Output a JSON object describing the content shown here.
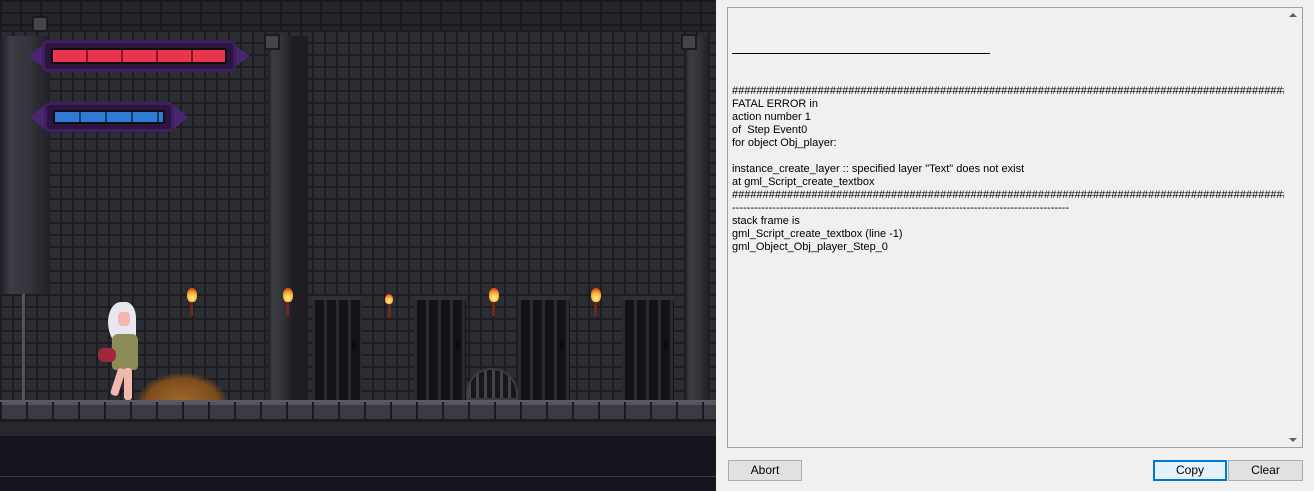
{
  "game": {
    "health": 1.0,
    "mana": 1.0,
    "colors": {
      "health": "#e8364f",
      "mana": "#2f7bd3",
      "frame": "#3f1f5e"
    }
  },
  "error_dialog": {
    "lines": [
      "############################################################################################",
      "FATAL ERROR in",
      "action number 1",
      "of  Step Event0",
      "for object Obj_player:",
      "",
      "instance_create_layer :: specified layer \"Text\" does not exist",
      "at gml_Script_create_textbox",
      "############################################################################################",
      "--------------------------------------------------------------------------------------------",
      "stack frame is",
      "gml_Script_create_textbox (line -1)",
      "gml_Object_Obj_player_Step_0"
    ],
    "buttons": {
      "abort": "Abort",
      "copy": "Copy",
      "clear": "Clear"
    }
  }
}
